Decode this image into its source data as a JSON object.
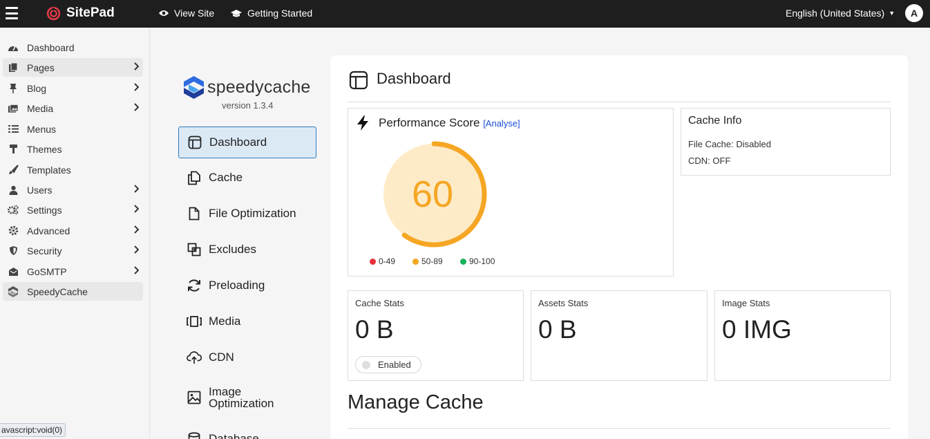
{
  "topbar": {
    "brand": "SitePad",
    "view_site": "View Site",
    "getting_started": "Getting Started",
    "language": "English (United States)",
    "avatar_letter": "A"
  },
  "sidebar": {
    "items": [
      {
        "label": "Dashboard",
        "icon": "dashboard-icon",
        "chevron": false
      },
      {
        "label": "Pages",
        "icon": "pages-icon",
        "chevron": true
      },
      {
        "label": "Blog",
        "icon": "pin-icon",
        "chevron": true
      },
      {
        "label": "Media",
        "icon": "media-icon",
        "chevron": true
      },
      {
        "label": "Menus",
        "icon": "menu-list-icon",
        "chevron": false
      },
      {
        "label": "Themes",
        "icon": "paint-roller-icon",
        "chevron": false
      },
      {
        "label": "Templates",
        "icon": "brush-icon",
        "chevron": false
      },
      {
        "label": "Users",
        "icon": "user-icon",
        "chevron": true
      },
      {
        "label": "Settings",
        "icon": "gears-icon",
        "chevron": true
      },
      {
        "label": "Advanced",
        "icon": "gear-icon",
        "chevron": true
      },
      {
        "label": "Security",
        "icon": "shield-icon",
        "chevron": true
      },
      {
        "label": "GoSMTP",
        "icon": "mail-icon",
        "chevron": true
      },
      {
        "label": "SpeedyCache",
        "icon": "speedycache-icon",
        "chevron": false
      }
    ],
    "chevron_glyph": "›"
  },
  "status_url": "avascript:void(0)",
  "plugin": {
    "name": "speedycache",
    "version": "version 1.3.4",
    "nav": [
      {
        "label": "Dashboard",
        "icon": "layout-icon"
      },
      {
        "label": "Cache",
        "icon": "copy-icon"
      },
      {
        "label": "File Optimization",
        "icon": "file-icon"
      },
      {
        "label": "Excludes",
        "icon": "exclude-icon"
      },
      {
        "label": "Preloading",
        "icon": "refresh-icon"
      },
      {
        "label": "Media",
        "icon": "media-frame-icon"
      },
      {
        "label": "CDN",
        "icon": "cloud-upload-icon"
      },
      {
        "label": "Image Optimization",
        "icon": "image-icon"
      },
      {
        "label": "Database",
        "icon": "database-icon"
      }
    ]
  },
  "main": {
    "title": "Dashboard",
    "performance": {
      "title": "Performance Score",
      "analyse": "[Analyse]",
      "score": 60,
      "score_text": "60",
      "legend": [
        {
          "label": "0-49",
          "color": "#e8303a"
        },
        {
          "label": "50-89",
          "color": "#f5a623"
        },
        {
          "label": "90-100",
          "color": "#18b35a"
        }
      ]
    },
    "cache_info": {
      "title": "Cache Info",
      "file_cache": "File Cache: Disabled",
      "cdn": "CDN: OFF"
    },
    "stats": [
      {
        "title": "Cache Stats",
        "value": "0 B"
      },
      {
        "title": "Assets Stats",
        "value": "0 B"
      },
      {
        "title": "Image Stats",
        "value": "0 IMG"
      }
    ],
    "toggle_label": "Enabled",
    "manage_title": "Manage Cache"
  },
  "colors": {
    "accent": "#f5a623",
    "score_fill": "#fdebc8",
    "active_nav_bg": "#dbe9f5",
    "active_nav_border": "#2f79b8"
  }
}
